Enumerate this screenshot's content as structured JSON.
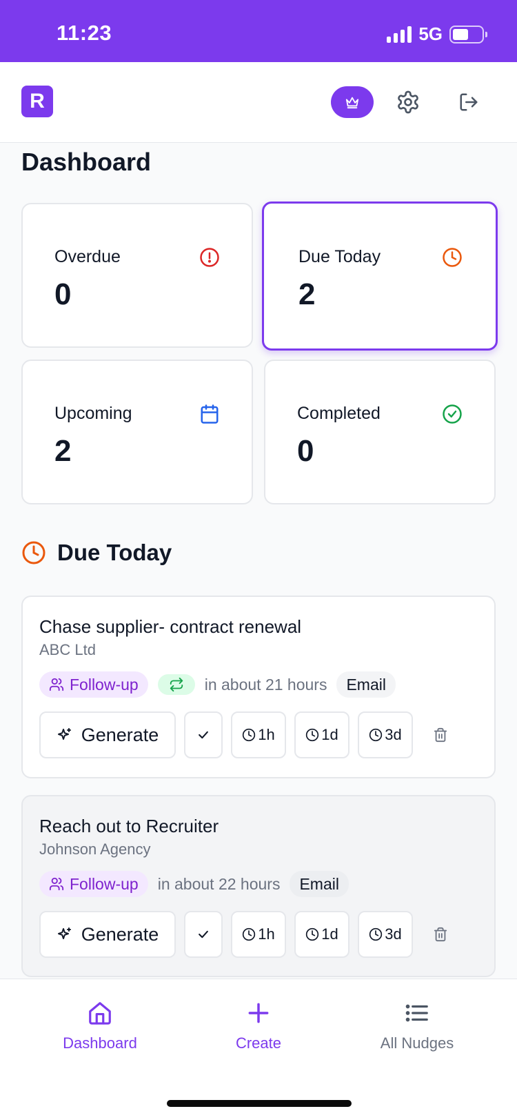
{
  "status_bar": {
    "time": "11:23",
    "network": "5G"
  },
  "header": {
    "logo_letter": "R"
  },
  "page_title": "Dashboard",
  "stats": [
    {
      "label": "Overdue",
      "value": "0",
      "icon": "alert-circle-icon",
      "color": "#dc2626"
    },
    {
      "label": "Due Today",
      "value": "2",
      "icon": "clock-icon",
      "color": "#ea580c"
    },
    {
      "label": "Upcoming",
      "value": "2",
      "icon": "calendar-icon",
      "color": "#2563eb"
    },
    {
      "label": "Completed",
      "value": "0",
      "icon": "check-circle-icon",
      "color": "#16a34a"
    }
  ],
  "section": {
    "title": "Due Today"
  },
  "tasks": [
    {
      "title": "Chase supplier- contract renewal",
      "company": "ABC Ltd",
      "type": "Follow-up",
      "repeat": true,
      "due": "in about 21 hours",
      "channel": "Email"
    },
    {
      "title": "Reach out to Recruiter",
      "company": "Johnson Agency",
      "type": "Follow-up",
      "repeat": false,
      "due": "in about 22 hours",
      "channel": "Email"
    }
  ],
  "actions": {
    "generate": "Generate",
    "snooze_1h": "1h",
    "snooze_1d": "1d",
    "snooze_3d": "3d"
  },
  "nav": [
    {
      "label": "Dashboard",
      "icon": "home-icon",
      "active": true
    },
    {
      "label": "Create",
      "icon": "plus-icon",
      "active": true
    },
    {
      "label": "All Nudges",
      "icon": "list-icon",
      "active": false
    }
  ],
  "colors": {
    "brand": "#7c3aed",
    "muted": "#6b7280",
    "border": "#e5e7eb"
  }
}
